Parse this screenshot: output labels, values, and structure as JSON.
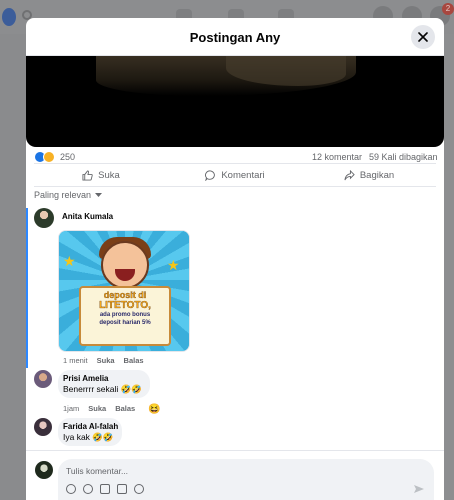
{
  "modal": {
    "title": "Postingan Any"
  },
  "stats": {
    "reaction_count": "250",
    "comments": "12 komentar",
    "shares": "59 Kali dibagikan"
  },
  "actions": {
    "like": "Suka",
    "comment": "Komentari",
    "share": "Bagikan"
  },
  "sort_label": "Paling relevan",
  "comments": [
    {
      "name": "Anita Kumala",
      "time": "1 menit",
      "like": "Suka",
      "reply": "Balas",
      "promo": {
        "line1": "deposit di",
        "line2": "LITETOTO,",
        "line3": "ada promo bonus",
        "line4": "deposit harian 5%"
      }
    },
    {
      "name": "Prisi Amelia",
      "text": "Benerrrr sekali 🤣🤣",
      "time": "1jam",
      "like": "Suka",
      "reply": "Balas",
      "reaction": "😆"
    },
    {
      "name": "Farida Al-falah",
      "text": "Iya kak 🤣🤣"
    }
  ],
  "composer": {
    "placeholder": "Tulis komentar..."
  },
  "background": {
    "notification_badge": "2"
  },
  "colors": {
    "accent": "#1b74e4",
    "thread_line": "#2d88ff"
  }
}
